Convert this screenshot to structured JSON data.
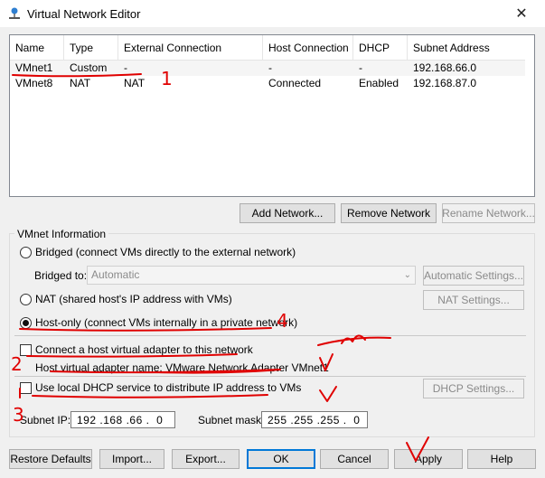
{
  "window": {
    "title": "Virtual Network Editor"
  },
  "list": {
    "headers": [
      "Name",
      "Type",
      "External Connection",
      "Host Connection",
      "DHCP",
      "Subnet Address"
    ],
    "rows": [
      [
        "VMnet1",
        "Custom",
        "-",
        "-",
        "-",
        "192.168.66.0"
      ],
      [
        "VMnet8",
        "NAT",
        "NAT",
        "Connected",
        "Enabled",
        "192.168.87.0"
      ]
    ]
  },
  "list_buttons": {
    "add": "Add Network...",
    "remove": "Remove Network",
    "rename": "Rename Network..."
  },
  "info": {
    "group_label": "VMnet Information",
    "bridged_label": "Bridged (connect VMs directly to the external network)",
    "bridged_to_label": "Bridged to:",
    "bridged_to_value": "Automatic",
    "auto_settings": "Automatic Settings...",
    "nat_label": "NAT (shared host's IP address with VMs)",
    "nat_settings": "NAT Settings...",
    "hostonly_label": "Host-only (connect VMs internally in a private network)",
    "connect_adapter_label": "Connect a host virtual adapter to this network",
    "adapter_name_label": "Host virtual adapter name: VMware Network Adapter VMnet1",
    "dhcp_label": "Use local DHCP service to distribute IP address to VMs",
    "dhcp_settings": "DHCP Settings...",
    "subnet_ip_label": "Subnet IP:",
    "subnet_ip": [
      "192",
      "168",
      "66",
      "0"
    ],
    "subnet_mask_label": "Subnet mask:",
    "subnet_mask": [
      "255",
      "255",
      "255",
      "0"
    ]
  },
  "footer": {
    "restore": "Restore Defaults",
    "import": "Import...",
    "export": "Export...",
    "ok": "OK",
    "cancel": "Cancel",
    "apply": "Apply",
    "help": "Help"
  },
  "annotations": [
    "1",
    "2",
    "3",
    "4"
  ],
  "colors": {
    "annotation": "#e00000",
    "selection_border": "#0078d7"
  }
}
